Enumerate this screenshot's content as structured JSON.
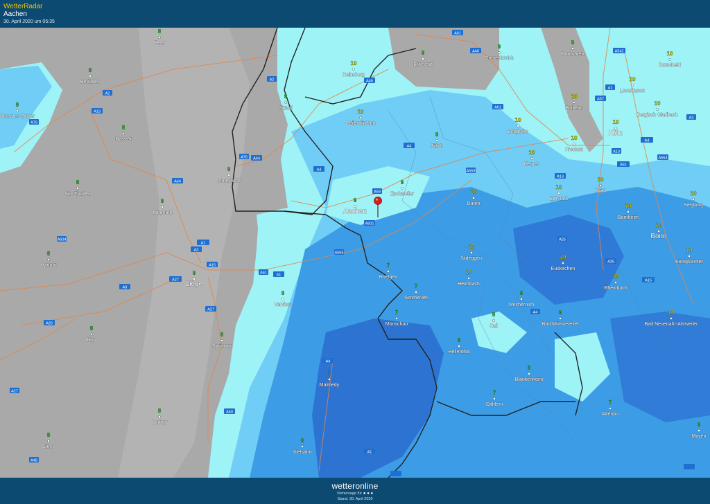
{
  "header": {
    "brand": "WetterRadar",
    "location": "Aachen",
    "timestamp": "30. April 2020 um 05:35"
  },
  "footer": {
    "logo": "wetteronline",
    "subtitle": "Vorhersage für",
    "stand": "Stand: 30. April 2020"
  },
  "colors": {
    "header_bg": "#0d4a72",
    "no_data_gray": "#a9a9a9",
    "rain_very_light": "#9ef3f7",
    "rain_light": "#6fcdf6",
    "rain_moderate": "#3c9de6",
    "rain_heavy": "#2d74d2",
    "temp_green": "#34d030",
    "temp_yellow": "#e6e600",
    "road_orange": "#e2854a",
    "border_black": "#222222"
  },
  "pin": {
    "icon": "map-pin-icon",
    "place": "Aachen"
  },
  "cities": [
    {
      "name": "Peer",
      "temp": "8"
    },
    {
      "name": "Beringen",
      "temp": "8"
    },
    {
      "name": "Heusden-Zolder",
      "temp": "8"
    },
    {
      "name": "Hasselt",
      "temp": "8"
    },
    {
      "name": "Sint-Truiden",
      "temp": "8"
    },
    {
      "name": "Tongeren",
      "temp": "9"
    },
    {
      "name": "Hannut",
      "temp": "8"
    },
    {
      "name": "Liège",
      "temp": "9"
    },
    {
      "name": "Huy",
      "temp": "8"
    },
    {
      "name": "Sprimont",
      "temp": "8"
    },
    {
      "name": "Durbuy",
      "temp": "8"
    },
    {
      "name": "Ciney",
      "temp": "8"
    },
    {
      "name": "Maastricht",
      "temp": "9"
    },
    {
      "name": "Sittard",
      "temp": "9"
    },
    {
      "name": "Heinsberg",
      "temp": "10"
    },
    {
      "name": "Geilenkirchen",
      "temp": "10"
    },
    {
      "name": "Erkelenz",
      "temp": "9"
    },
    {
      "name": "Grevenbroich",
      "temp": "9"
    },
    {
      "name": "Dormagen",
      "temp": "9"
    },
    {
      "name": "Burscheid",
      "temp": "10"
    },
    {
      "name": "Leverkusen",
      "temp": "10"
    },
    {
      "name": "Pulheim",
      "temp": "10"
    },
    {
      "name": "Bergisch Gladbach",
      "temp": "10"
    },
    {
      "name": "Bergheim",
      "temp": "10"
    },
    {
      "name": "Köln",
      "temp": "10"
    },
    {
      "name": "Frechen",
      "temp": "10"
    },
    {
      "name": "Kerpen",
      "temp": "10"
    },
    {
      "name": "Jülich",
      "temp": "9"
    },
    {
      "name": "Eschweiler",
      "temp": "9"
    },
    {
      "name": "Aachen",
      "temp": "9"
    },
    {
      "name": "Düren",
      "temp": "10"
    },
    {
      "name": "Erftstadt",
      "temp": "10"
    },
    {
      "name": "Brühl",
      "temp": "10"
    },
    {
      "name": "Siegburg",
      "temp": "10"
    },
    {
      "name": "Bornheim",
      "temp": "10"
    },
    {
      "name": "Bonn",
      "temp": "10"
    },
    {
      "name": "Königswinter",
      "temp": "10"
    },
    {
      "name": "Nideggen",
      "temp": "10"
    },
    {
      "name": "Euskirchen",
      "temp": "10"
    },
    {
      "name": "Heimbach",
      "temp": "10"
    },
    {
      "name": "Rheinbach",
      "temp": "10"
    },
    {
      "name": "Roetgen",
      "temp": "7"
    },
    {
      "name": "Simmerath",
      "temp": "7"
    },
    {
      "name": "Verviers",
      "temp": "9"
    },
    {
      "name": "Monschau",
      "temp": "7"
    },
    {
      "name": "Mechernich",
      "temp": "9"
    },
    {
      "name": "Kall",
      "temp": "8"
    },
    {
      "name": "Bad Münstereifel",
      "temp": "9"
    },
    {
      "name": "Bad Neuenahr-Ahrweiler",
      "temp": "10"
    },
    {
      "name": "Hellenthal",
      "temp": "8"
    },
    {
      "name": "Malmedy",
      "temp": "7"
    },
    {
      "name": "Blankenheim",
      "temp": "8"
    },
    {
      "name": "Dahlem",
      "temp": "7"
    },
    {
      "name": "Adenau",
      "temp": "7"
    },
    {
      "name": "Vielsalm",
      "temp": "6"
    },
    {
      "name": "Mayen",
      "temp": "9"
    }
  ],
  "roads": [
    "A61",
    "A46",
    "A542",
    "A2",
    "A46",
    "A1",
    "A57",
    "A61",
    "A3",
    "A13",
    "A2",
    "A79",
    "A76",
    "A44",
    "A4",
    "A4",
    "A559",
    "A59",
    "A13",
    "A4",
    "A553",
    "A44",
    "A61",
    "A601",
    "A13",
    "A1",
    "A3",
    "A25",
    "A604",
    "A15",
    "A27",
    "A3",
    "A1",
    "A61",
    "A565",
    "A25",
    "A15",
    "A4",
    "A27",
    "A26",
    "A4",
    "A27",
    "A60",
    "A48",
    "A1"
  ]
}
